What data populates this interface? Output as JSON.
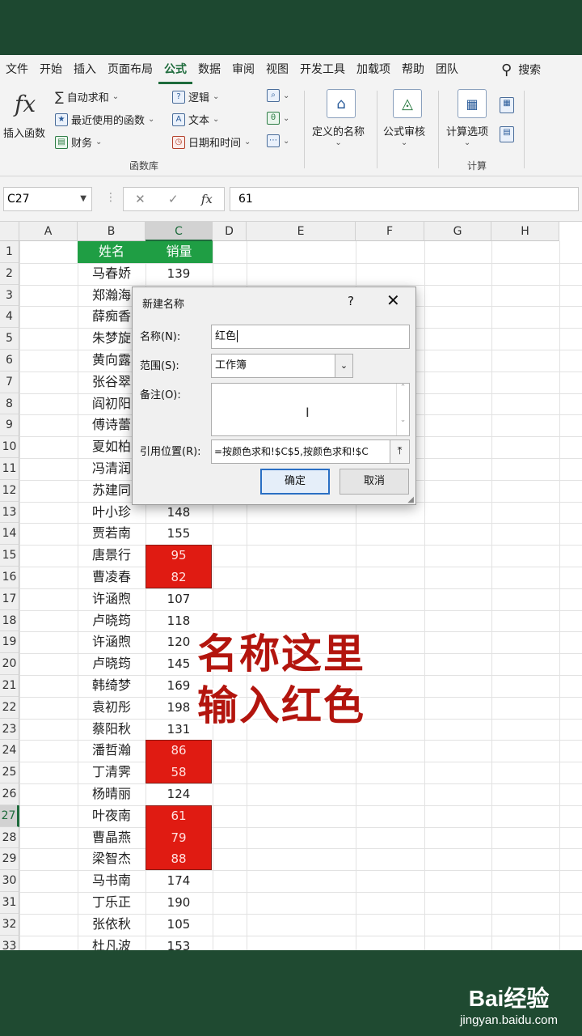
{
  "menu": {
    "tabs": [
      "文件",
      "开始",
      "插入",
      "页面布局",
      "公式",
      "数据",
      "审阅",
      "视图",
      "开发工具",
      "加载项",
      "帮助",
      "团队"
    ],
    "active_index": 4,
    "search_label": "搜索"
  },
  "ribbon": {
    "insert_function": "插入函数",
    "autosum": "自动求和",
    "recent": "最近使用的函数",
    "finance": "财务",
    "logic": "逻辑",
    "text": "文本",
    "datetime": "日期和时间",
    "function_library": "函数库",
    "define_name": "定义的名称",
    "formula_audit": "公式审核",
    "calc_options": "计算选项",
    "calculation": "计算"
  },
  "formula_bar": {
    "name_box": "C27",
    "fx": "fx",
    "value": "61"
  },
  "grid": {
    "columns": [
      "A",
      "B",
      "C",
      "D",
      "E",
      "F",
      "G",
      "H"
    ],
    "selected_column": "C",
    "header_row": {
      "name": "姓名",
      "sales": "销量"
    },
    "rows": [
      {
        "n": "1"
      },
      {
        "n": "2",
        "name": "马春娇",
        "sales": "139"
      },
      {
        "n": "3",
        "name": "郑瀚海"
      },
      {
        "n": "4",
        "name": "薛痴香"
      },
      {
        "n": "5",
        "name": "朱梦旋"
      },
      {
        "n": "6",
        "name": "黄向露"
      },
      {
        "n": "7",
        "name": "张谷翠"
      },
      {
        "n": "8",
        "name": "阎初阳"
      },
      {
        "n": "9",
        "name": "傅诗蕾"
      },
      {
        "n": "10",
        "name": "夏如柏"
      },
      {
        "n": "11",
        "name": "冯清润"
      },
      {
        "n": "12",
        "name": "苏建同"
      },
      {
        "n": "13",
        "name": "叶小珍",
        "sales": "148"
      },
      {
        "n": "14",
        "name": "贾若南",
        "sales": "155"
      },
      {
        "n": "15",
        "name": "唐景行",
        "sales": "95",
        "red": true
      },
      {
        "n": "16",
        "name": "曹凌春",
        "sales": "82",
        "red": true
      },
      {
        "n": "17",
        "name": "许涵煦",
        "sales": "107"
      },
      {
        "n": "18",
        "name": "卢晓筠",
        "sales": "118"
      },
      {
        "n": "19",
        "name": "许涵煦",
        "sales": "120"
      },
      {
        "n": "20",
        "name": "卢晓筠",
        "sales": "145"
      },
      {
        "n": "21",
        "name": "韩绮梦",
        "sales": "169"
      },
      {
        "n": "22",
        "name": "袁初彤",
        "sales": "198"
      },
      {
        "n": "23",
        "name": "蔡阳秋",
        "sales": "131"
      },
      {
        "n": "24",
        "name": "潘哲瀚",
        "sales": "86",
        "red": true
      },
      {
        "n": "25",
        "name": "丁清霁",
        "sales": "58",
        "red": true
      },
      {
        "n": "26",
        "name": "杨晴丽",
        "sales": "124"
      },
      {
        "n": "27",
        "name": "叶夜南",
        "sales": "61",
        "red": true
      },
      {
        "n": "28",
        "name": "曹晶燕",
        "sales": "79",
        "red": true
      },
      {
        "n": "29",
        "name": "梁智杰",
        "sales": "88",
        "red": true
      },
      {
        "n": "30",
        "name": "马书南",
        "sales": "174"
      },
      {
        "n": "31",
        "name": "丁乐正",
        "sales": "190"
      },
      {
        "n": "32",
        "name": "张依秋",
        "sales": "105"
      },
      {
        "n": "33",
        "name": "杜凡波",
        "sales": "153"
      }
    ]
  },
  "dialog": {
    "title": "新建名称",
    "help": "?",
    "name_label": "名称(N):",
    "name_value": "红色",
    "scope_label": "范围(S):",
    "scope_value": "工作簿",
    "comment_label": "备注(O):",
    "ref_label": "引用位置(R):",
    "ref_value": "=按颜色求和!$C$5,按颜色求和!$C",
    "ok": "确定",
    "cancel": "取消"
  },
  "caption": {
    "line1": "名称这里",
    "line2": "输入红色"
  },
  "watermark": {
    "brand": "Bai经验",
    "url": "jingyan.baidu.com"
  }
}
